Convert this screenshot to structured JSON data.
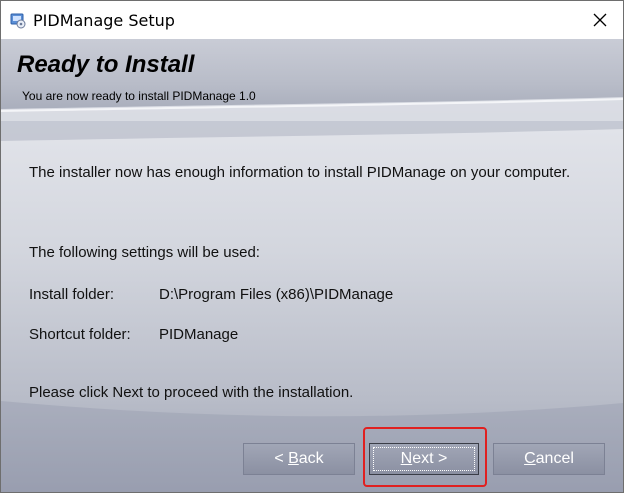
{
  "window": {
    "title": "PIDManage Setup",
    "icon": "installer-icon",
    "close_icon": "close-icon"
  },
  "header": {
    "title": "Ready to Install",
    "subtitle": "You are now ready to install PIDManage 1.0"
  },
  "content": {
    "intro": "The installer now has enough information to install PIDManage on your computer.",
    "settings_heading": "The following settings will be used:",
    "settings": [
      {
        "label": "Install folder:",
        "value": "D:\\Program Files (x86)\\PIDManage"
      },
      {
        "label": "Shortcut folder:",
        "value": "PIDManage"
      }
    ],
    "proceed": "Please click Next to proceed with the installation."
  },
  "buttons": {
    "back_prefix": "< ",
    "back_accel": "B",
    "back_rest": "ack",
    "next_accel": "N",
    "next_rest": "ext >",
    "cancel_accel": "C",
    "cancel_rest": "ancel"
  },
  "colors": {
    "highlight": "#e02020",
    "button_bg": "#959aac"
  }
}
